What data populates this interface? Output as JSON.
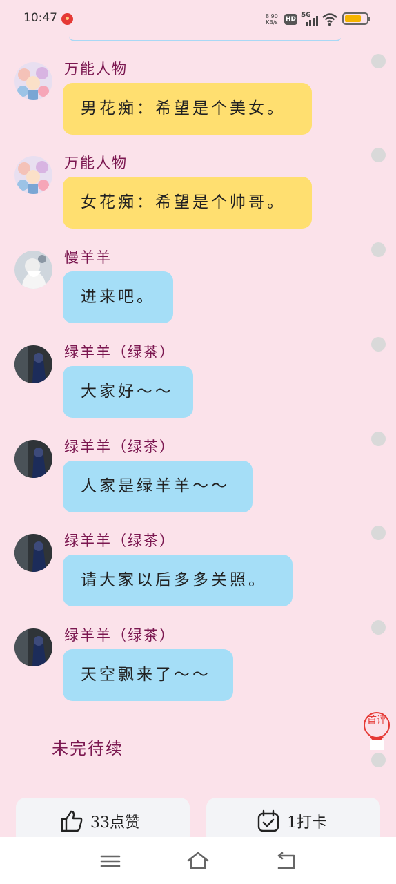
{
  "status_bar": {
    "time": "10:47",
    "net_speed_value": "8.90",
    "net_speed_unit": "KB/s",
    "hd": "HD",
    "network": "5G",
    "battery_level": 0.75
  },
  "messages": [
    {
      "sender": "万能人物",
      "text": "男花痴：希望是个美女。",
      "style": "yellow",
      "avatar": "anime-group-avatar"
    },
    {
      "sender": "万能人物",
      "text": "女花痴：希望是个帅哥。",
      "style": "yellow",
      "avatar": "anime-group-avatar"
    },
    {
      "sender": "慢羊羊",
      "text": "进来吧。",
      "style": "blue",
      "avatar": "old-man-avatar"
    },
    {
      "sender": "绿羊羊（绿茶）",
      "text": "大家好～～",
      "style": "blue",
      "avatar": "dark-figure-avatar"
    },
    {
      "sender": "绿羊羊（绿茶）",
      "text": "人家是绿羊羊～～",
      "style": "blue",
      "avatar": "dark-figure-avatar"
    },
    {
      "sender": "绿羊羊（绿茶）",
      "text": "请大家以后多多关照。",
      "style": "blue",
      "avatar": "dark-figure-avatar"
    },
    {
      "sender": "绿羊羊（绿茶）",
      "text": "天空飘来了～～",
      "style": "blue",
      "avatar": "dark-figure-avatar"
    }
  ],
  "footer_text": "未完待续",
  "first_review_badge": "首评",
  "actions": {
    "like_label": "33点赞",
    "checkin_label": "1打卡"
  },
  "colors": {
    "background": "#fbe2ea",
    "name": "#7b1750",
    "yellow_bubble": "#ffdf70",
    "blue_bubble": "#a5def7"
  }
}
